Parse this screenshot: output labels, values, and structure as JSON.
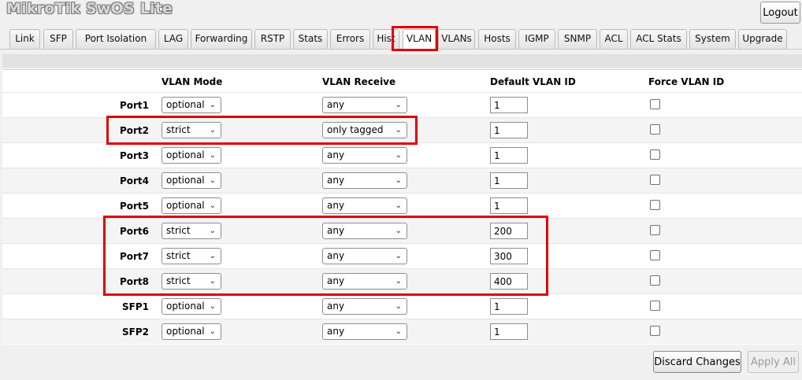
{
  "app": {
    "title": "MikroTik SwOS Lite",
    "logout_label": "Logout"
  },
  "tabs": [
    {
      "label": "Link"
    },
    {
      "label": "SFP"
    },
    {
      "label": "Port Isolation"
    },
    {
      "label": "LAG"
    },
    {
      "label": "Forwarding"
    },
    {
      "label": "RSTP"
    },
    {
      "label": "Stats"
    },
    {
      "label": "Errors"
    },
    {
      "label": "Hist"
    },
    {
      "label": "VLAN",
      "active": true
    },
    {
      "label": "VLANs"
    },
    {
      "label": "Hosts"
    },
    {
      "label": "IGMP"
    },
    {
      "label": "SNMP"
    },
    {
      "label": "ACL"
    },
    {
      "label": "ACL Stats"
    },
    {
      "label": "System"
    },
    {
      "label": "Upgrade"
    }
  ],
  "table": {
    "headers": {
      "vlan_mode": "VLAN Mode",
      "vlan_receive": "VLAN Receive",
      "default_vlan_id": "Default VLAN ID",
      "force_vlan_id": "Force VLAN ID"
    },
    "rows": [
      {
        "port": "Port1",
        "mode": "optional",
        "receive": "any",
        "pvid": "1",
        "force": false
      },
      {
        "port": "Port2",
        "mode": "strict",
        "receive": "only tagged",
        "pvid": "1",
        "force": false
      },
      {
        "port": "Port3",
        "mode": "optional",
        "receive": "any",
        "pvid": "1",
        "force": false
      },
      {
        "port": "Port4",
        "mode": "optional",
        "receive": "any",
        "pvid": "1",
        "force": false
      },
      {
        "port": "Port5",
        "mode": "optional",
        "receive": "any",
        "pvid": "1",
        "force": false
      },
      {
        "port": "Port6",
        "mode": "strict",
        "receive": "any",
        "pvid": "200",
        "force": false
      },
      {
        "port": "Port7",
        "mode": "strict",
        "receive": "any",
        "pvid": "300",
        "force": false
      },
      {
        "port": "Port8",
        "mode": "strict",
        "receive": "any",
        "pvid": "400",
        "force": false
      },
      {
        "port": "SFP1",
        "mode": "optional",
        "receive": "any",
        "pvid": "1",
        "force": false
      },
      {
        "port": "SFP2",
        "mode": "optional",
        "receive": "any",
        "pvid": "1",
        "force": false
      }
    ]
  },
  "footer": {
    "discard_label": "Discard Changes",
    "apply_label": "Apply All"
  },
  "colors": {
    "highlight": "#e00000",
    "row_alt": "#f4f4f4",
    "background": "#f0f0f0"
  },
  "icons": {
    "select_arrow": "chevron-down-icon"
  }
}
